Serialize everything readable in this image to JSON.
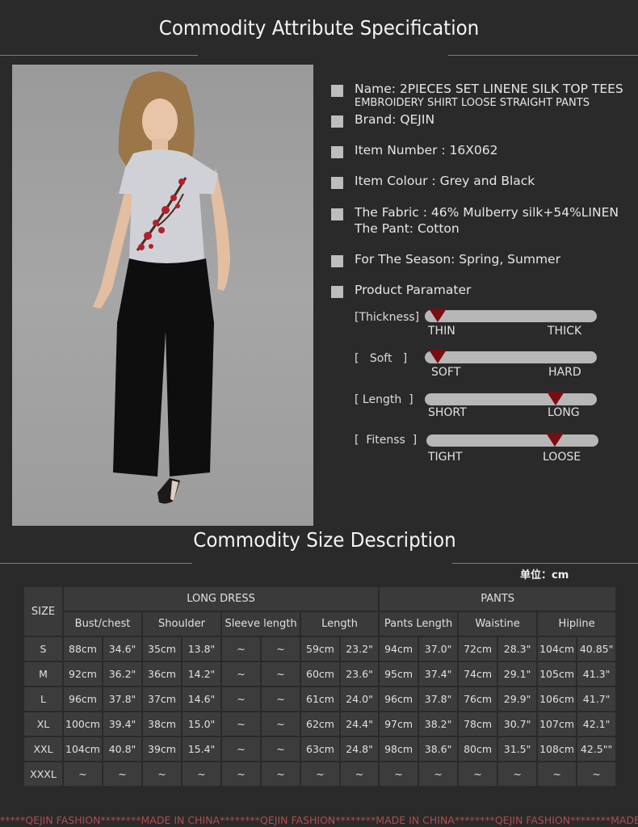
{
  "titles": {
    "attribute": "Commodity Attribute Specification",
    "size": "Commodity Size Description",
    "unit": "单位：cm"
  },
  "specs": {
    "name_line1": "Name: 2PIECES SET LINENE SILK TOP TEES",
    "name_line2": "EMBROIDERY SHIRT LOOSE STRAIGHT PANTS",
    "brand": "Brand: QEJIN",
    "item_number": "Item Number : 16X062",
    "colour": "Item Colour : Grey and Black",
    "fabric": "The Fabric : 46% Mulberry silk+54%LINEN",
    "pant": "The Pant: Cotton",
    "season": "For The Season:  Spring, Summer",
    "param_title": "Product Paramater"
  },
  "params": [
    {
      "label": "[Thickness]",
      "left": "THIN",
      "right": "THICK",
      "level": 0.08
    },
    {
      "label": "[   Soft   ]",
      "left": "SOFT",
      "right": "HARD",
      "level": 0.08
    },
    {
      "label": "[ Length  ]",
      "left": "SHORT",
      "right": "LONG",
      "level": 0.76
    },
    {
      "label": "[  Fitenss  ]",
      "left": "TIGHT",
      "right": "LOOSE",
      "level": 0.75
    }
  ],
  "table": {
    "size_header": "SIZE",
    "group1": "LONG DRESS",
    "group2": "PANTS",
    "columns": [
      "Bust/chest",
      "Shoulder",
      "Sleeve length",
      "Length",
      "Pants Length",
      "Waistine",
      "Hipline"
    ],
    "rows": [
      [
        "S",
        "88cm",
        "34.6\"",
        "35cm",
        "13.8\"",
        "~",
        "~",
        "59cm",
        "23.2\"",
        "94cm",
        "37.0\"",
        "72cm",
        "28.3\"",
        "104cm",
        "40.85\""
      ],
      [
        "M",
        "92cm",
        "36.2\"",
        "36cm",
        "14.2\"",
        "~",
        "~",
        "60cm",
        "23.6\"",
        "95cm",
        "37.4\"",
        "74cm",
        "29.1\"",
        "105cm",
        "41.3\""
      ],
      [
        "L",
        "96cm",
        "37.8\"",
        "37cm",
        "14.6\"",
        "~",
        "~",
        "61cm",
        "24.0\"",
        "96cm",
        "37.8\"",
        "76cm",
        "29.9\"",
        "106cm",
        "41.7\""
      ],
      [
        "XL",
        "100cm",
        "39.4\"",
        "38cm",
        "15.0\"",
        "~",
        "~",
        "62cm",
        "24.4\"",
        "97cm",
        "38.2\"",
        "78cm",
        "30.7\"",
        "107cm",
        "42.1\""
      ],
      [
        "XXL",
        "104cm",
        "40.8\"",
        "39cm",
        "15.4\"",
        "~",
        "~",
        "63cm",
        "24.8\"",
        "98cm",
        "38.6\"",
        "80cm",
        "31.5\"",
        "108cm",
        "42.5\"\""
      ],
      [
        "XXXL",
        "~",
        "~",
        "~",
        "~",
        "~",
        "~",
        "~",
        "~",
        "~",
        "~",
        "~",
        "~",
        "~",
        "~"
      ]
    ]
  },
  "footer": "*****QEJIN FASHION********MADE IN CHINA********QEJIN FASHION********MADE IN CHINA********QEJIN FASHION********MADE IN CH",
  "colors": {
    "background": "#2a2a2a",
    "marker": "#7a0d12",
    "track": "#b7b7b7",
    "cell": "#3c3c3c"
  }
}
